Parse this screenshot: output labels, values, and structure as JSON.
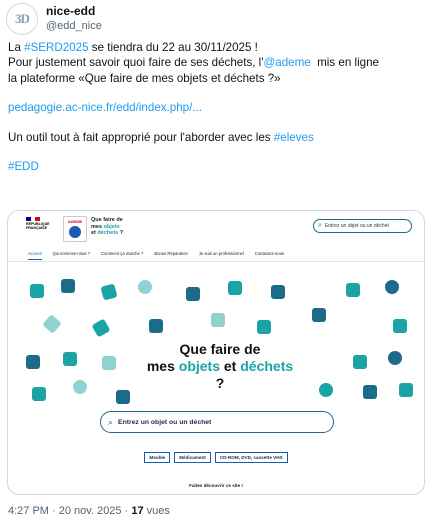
{
  "author": {
    "display_name": "nice-edd",
    "handle": "@edd_nice",
    "avatar_text": "3D"
  },
  "tweet": {
    "line1_pre": "La ",
    "line1_tag": "#SERD2025",
    "line1_post": " se tiendra du 22 au 30/11/2025 !",
    "line2_pre": "Pour justement savoir quoi faire de ses déchets, l'",
    "line2_mention": "@ademe",
    "line2_post": "  mis en ligne",
    "line3": "la plateforme «Que faire de mes objets et déchets ?»",
    "link": "pedagogie.ac-nice.fr/edd/index.php/...",
    "line4_pre": "Un outil tout à fait approprié pour l'aborder avec les ",
    "line4_tag": "#eleves",
    "hashtag_edd": "#EDD"
  },
  "card": {
    "gov_logo_text": "RÉPUBLIQUE FRANÇAISE",
    "ademe_label": "ADEME",
    "site_title_1": "Que faire de",
    "site_title_2a": "mes ",
    "site_title_2b": "objets",
    "site_title_3a": "et ",
    "site_title_3b": "déchets",
    "site_title_3c": " ?",
    "top_search_placeholder": "Entrez un objet ou un déchet",
    "nav": [
      "Accueil",
      "Qui sommes-nous ?",
      "Comment ça marche ?",
      "Bonus Réparation",
      "Je suis un professionnel",
      "Contactez-nous"
    ],
    "hero_line1": "Que faire de",
    "hero_line2a": "mes ",
    "hero_line2b": "objets",
    "hero_line2c": " et ",
    "hero_line2d": "déchets",
    "hero_line2e": " ?",
    "main_search_placeholder": "Entrez un objet ou un déchet",
    "chips": [
      "Meuble",
      "Médicament",
      "CD-ROM, DVD, cassette VHS"
    ],
    "discover_text": "Faites découvrir ce site !"
  },
  "meta": {
    "time": "4:27 PM",
    "sep1": " · ",
    "date": "20 nov. 2025",
    "sep2": " · ",
    "views_count": "17",
    "views_label": " vues"
  },
  "colors": {
    "link": "#1d9bf0",
    "accent_teal": "#1aa4a5",
    "accent_blue": "#1c5bb4",
    "muted": "#536471"
  }
}
